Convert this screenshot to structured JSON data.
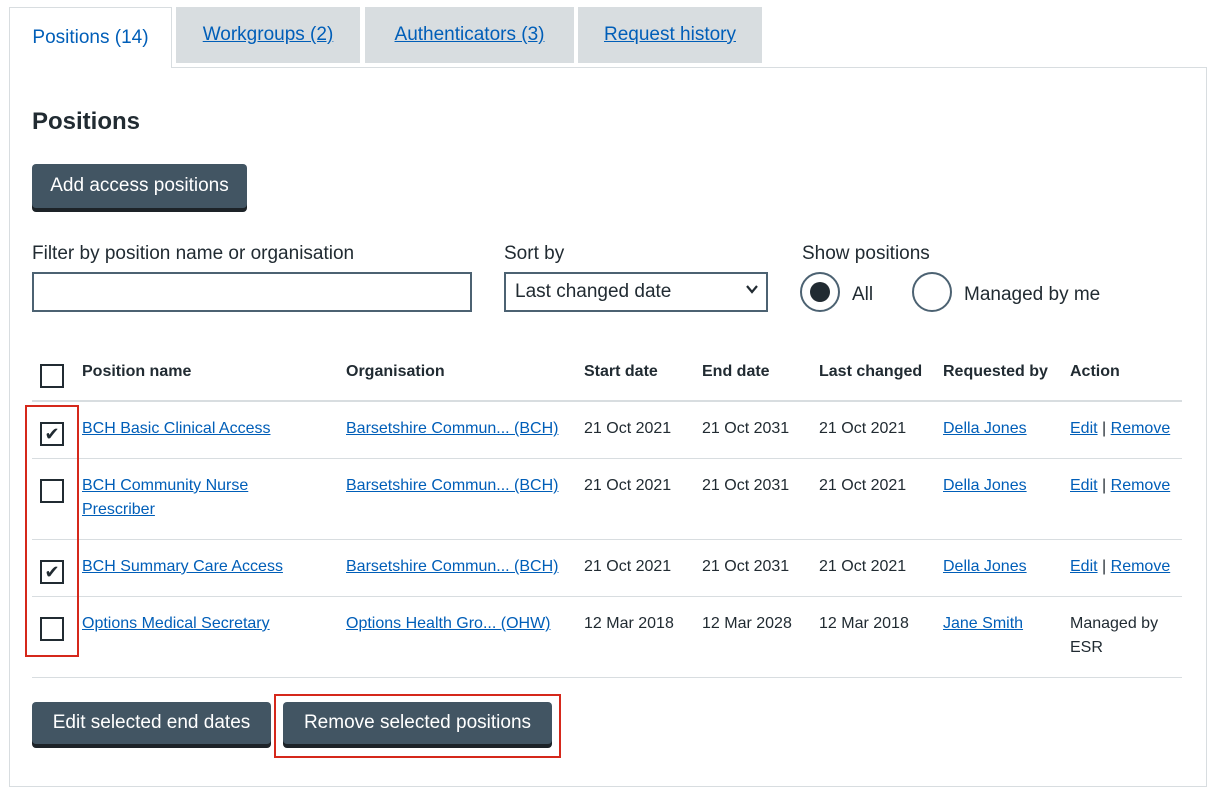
{
  "tabs": [
    {
      "label": "Positions (14)"
    },
    {
      "label": "Workgroups (2)"
    },
    {
      "label": "Authenticators (3)"
    },
    {
      "label": "Request history"
    }
  ],
  "heading": "Positions",
  "add_button": "Add access positions",
  "filter": {
    "label": "Filter by position name or organisation",
    "value": "",
    "placeholder": ""
  },
  "sort": {
    "label": "Sort by",
    "selected": "Last changed date"
  },
  "show": {
    "label": "Show positions",
    "options": [
      {
        "label": "All",
        "selected": true
      },
      {
        "label": "Managed by me",
        "selected": false
      }
    ]
  },
  "table": {
    "headers": [
      "Position name",
      "Organisation",
      "Start date",
      "End date",
      "Last changed",
      "Requested by",
      "Action"
    ],
    "rows": [
      {
        "checked": true,
        "name": "BCH Basic Clinical Access",
        "org": "Barsetshire Commun... (BCH)",
        "start": "21 Oct 2021",
        "end": "21 Oct 2031",
        "changed": "21 Oct 2021",
        "by": "Della Jones",
        "edit": "Edit",
        "sep": "|",
        "remove": "Remove"
      },
      {
        "checked": false,
        "name_l1": "BCH Community Nurse",
        "name_l2": "Prescriber",
        "org": "Barsetshire Commun... (BCH)",
        "start": "21 Oct 2021",
        "end": "21 Oct 2031",
        "changed": "21 Oct 2021",
        "by": "Della Jones",
        "edit": "Edit",
        "sep": "|",
        "remove": "Remove"
      },
      {
        "checked": true,
        "name": "BCH Summary Care Access",
        "org": "Barsetshire Commun... (BCH)",
        "start": "21 Oct 2021",
        "end": "21 Oct 2031",
        "changed": "21 Oct 2021",
        "by": "Della Jones",
        "edit": "Edit",
        "sep": "|",
        "remove": "Remove"
      },
      {
        "checked": false,
        "name": "Options Medical Secretary",
        "org": "Options Health Gro... (OHW)",
        "start": "12 Mar 2018",
        "end": "12 Mar 2028",
        "changed": "12 Mar 2018",
        "by": "Jane Smith",
        "action_l1": "Managed by",
        "action_l2": "ESR"
      }
    ]
  },
  "buttons": {
    "edit_dates": "Edit selected end dates",
    "remove_positions": "Remove selected positions"
  },
  "check_glyph": "✔",
  "colors": {
    "link": "#005eb8",
    "button": "#425563",
    "highlight": "#d5281b"
  }
}
